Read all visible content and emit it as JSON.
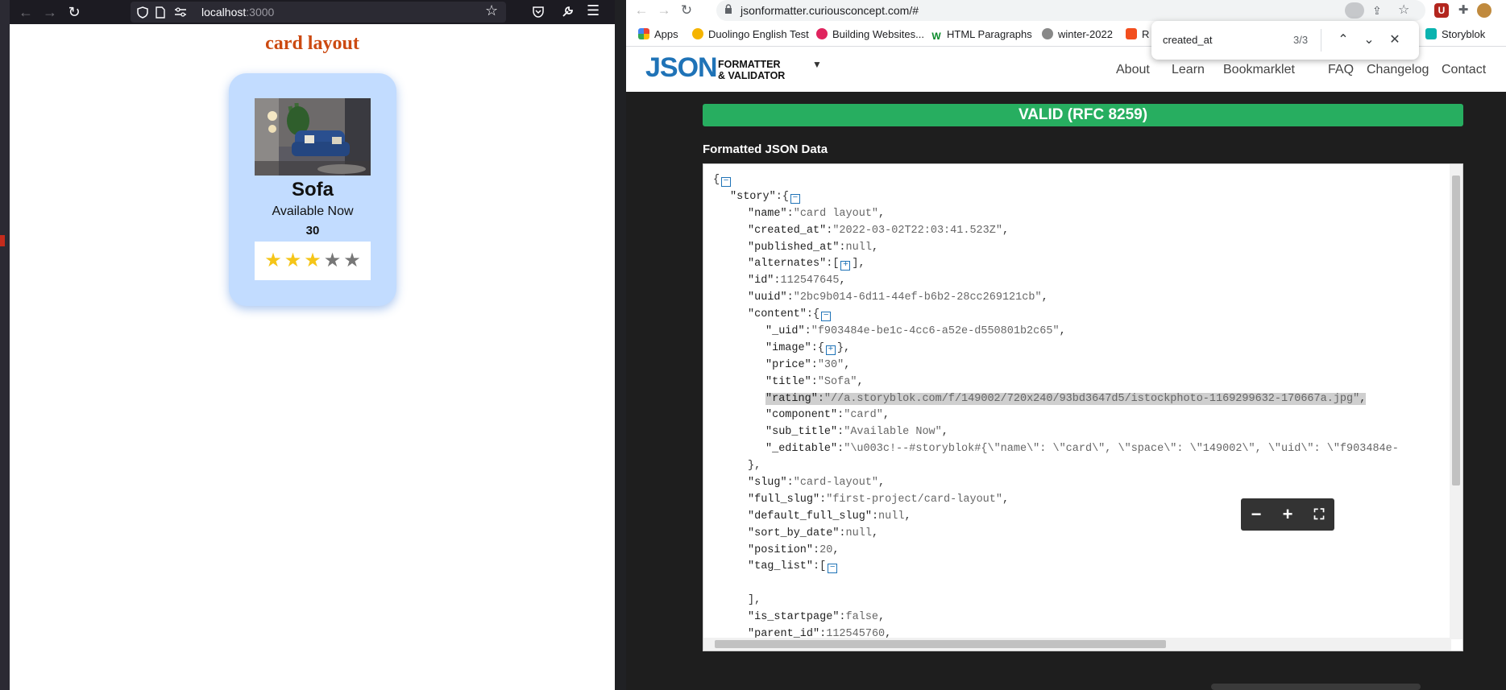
{
  "firefox": {
    "url_host": "localhost",
    "url_port": ":3000",
    "page": {
      "heading": "card layout",
      "card": {
        "image_alt": "Sofa",
        "title": "Sofa",
        "subtitle": "Available Now",
        "price": "30",
        "rating": {
          "value": 3,
          "max": 5
        }
      }
    }
  },
  "chrome": {
    "url": "jsonformatter.curiousconcept.com/#",
    "bookmarks": [
      "Apps",
      "Duolingo English Test",
      "Building Websites...",
      "HTML Paragraphs",
      "winter-2022",
      "R",
      "Storyblok"
    ],
    "find": {
      "query": "created_at",
      "count": "3/3"
    },
    "site": {
      "logo": "JSON",
      "logo_sub_1": "FORMATTER",
      "logo_sub_2": "& VALIDATOR",
      "nav": [
        "About",
        "Learn",
        "Bookmarklet",
        "FAQ",
        "Changelog",
        "Contact"
      ]
    },
    "validation": "VALID (RFC 8259)",
    "section_title": "Formatted JSON Data",
    "json_lines": [
      {
        "indent": 0,
        "parts": [
          [
            "p",
            "{"
          ],
          [
            "t",
            "−"
          ]
        ]
      },
      {
        "indent": 1,
        "parts": [
          [
            "k",
            "\"story\""
          ],
          [
            "p",
            ":{"
          ],
          [
            "t",
            "−"
          ]
        ]
      },
      {
        "indent": 2,
        "parts": [
          [
            "k",
            "\"name\""
          ],
          [
            "p",
            ":"
          ],
          [
            "s",
            "\"card layout\""
          ],
          [
            "p",
            ","
          ]
        ]
      },
      {
        "indent": 2,
        "parts": [
          [
            "k",
            "\"created_at\""
          ],
          [
            "p",
            ":"
          ],
          [
            "s",
            "\"2022-03-02T22:03:41.523Z\""
          ],
          [
            "p",
            ","
          ]
        ]
      },
      {
        "indent": 2,
        "parts": [
          [
            "k",
            "\"published_at\""
          ],
          [
            "p",
            ":"
          ],
          [
            "n",
            "null"
          ],
          [
            "p",
            ","
          ]
        ]
      },
      {
        "indent": 2,
        "parts": [
          [
            "k",
            "\"alternates\""
          ],
          [
            "p",
            ":["
          ],
          [
            "t",
            "+"
          ],
          [
            "p",
            "],"
          ]
        ]
      },
      {
        "indent": 2,
        "parts": [
          [
            "k",
            "\"id\""
          ],
          [
            "p",
            ":"
          ],
          [
            "n",
            "112547645"
          ],
          [
            "p",
            ","
          ]
        ]
      },
      {
        "indent": 2,
        "parts": [
          [
            "k",
            "\"uuid\""
          ],
          [
            "p",
            ":"
          ],
          [
            "s",
            "\"2bc9b014-6d11-44ef-b6b2-28cc269121cb\""
          ],
          [
            "p",
            ","
          ]
        ]
      },
      {
        "indent": 2,
        "parts": [
          [
            "k",
            "\"content\""
          ],
          [
            "p",
            ":{"
          ],
          [
            "t",
            "−"
          ]
        ]
      },
      {
        "indent": 3,
        "parts": [
          [
            "k",
            "\"_uid\""
          ],
          [
            "p",
            ":"
          ],
          [
            "s",
            "\"f903484e-be1c-4cc6-a52e-d550801b2c65\""
          ],
          [
            "p",
            ","
          ]
        ]
      },
      {
        "indent": 3,
        "parts": [
          [
            "k",
            "\"image\""
          ],
          [
            "p",
            ":{"
          ],
          [
            "t",
            "+"
          ],
          [
            "p",
            "},"
          ]
        ]
      },
      {
        "indent": 3,
        "parts": [
          [
            "k",
            "\"price\""
          ],
          [
            "p",
            ":"
          ],
          [
            "s",
            "\"30\""
          ],
          [
            "p",
            ","
          ]
        ]
      },
      {
        "indent": 3,
        "parts": [
          [
            "k",
            "\"title\""
          ],
          [
            "p",
            ":"
          ],
          [
            "s",
            "\"Sofa\""
          ],
          [
            "p",
            ","
          ]
        ]
      },
      {
        "indent": 3,
        "highlight": true,
        "parts": [
          [
            "k",
            "\"rating\""
          ],
          [
            "p",
            ":"
          ],
          [
            "s",
            "\"//a.storyblok.com/f/149002/720x240/93bd3647d5/istockphoto-1169299632-170667a.jpg\""
          ],
          [
            "p",
            ","
          ]
        ]
      },
      {
        "indent": 3,
        "parts": [
          [
            "k",
            "\"component\""
          ],
          [
            "p",
            ":"
          ],
          [
            "s",
            "\"card\""
          ],
          [
            "p",
            ","
          ]
        ]
      },
      {
        "indent": 3,
        "parts": [
          [
            "k",
            "\"sub_title\""
          ],
          [
            "p",
            ":"
          ],
          [
            "s",
            "\"Available Now\""
          ],
          [
            "p",
            ","
          ]
        ]
      },
      {
        "indent": 3,
        "parts": [
          [
            "k",
            "\"_editable\""
          ],
          [
            "p",
            ":"
          ],
          [
            "s",
            "\"\\u003c!--#storyblok#{\\\"name\\\": \\\"card\\\", \\\"space\\\": \\\"149002\\\", \\\"uid\\\": \\\"f903484e-"
          ]
        ]
      },
      {
        "indent": 2,
        "parts": [
          [
            "p",
            "},"
          ]
        ]
      },
      {
        "indent": 2,
        "parts": [
          [
            "k",
            "\"slug\""
          ],
          [
            "p",
            ":"
          ],
          [
            "s",
            "\"card-layout\""
          ],
          [
            "p",
            ","
          ]
        ]
      },
      {
        "indent": 2,
        "parts": [
          [
            "k",
            "\"full_slug\""
          ],
          [
            "p",
            ":"
          ],
          [
            "s",
            "\"first-project/card-layout\""
          ],
          [
            "p",
            ","
          ]
        ]
      },
      {
        "indent": 2,
        "parts": [
          [
            "k",
            "\"default_full_slug\""
          ],
          [
            "p",
            ":"
          ],
          [
            "n",
            "null"
          ],
          [
            "p",
            ","
          ]
        ]
      },
      {
        "indent": 2,
        "parts": [
          [
            "k",
            "\"sort_by_date\""
          ],
          [
            "p",
            ":"
          ],
          [
            "n",
            "null"
          ],
          [
            "p",
            ","
          ]
        ]
      },
      {
        "indent": 2,
        "parts": [
          [
            "k",
            "\"position\""
          ],
          [
            "p",
            ":"
          ],
          [
            "n",
            "20"
          ],
          [
            "p",
            ","
          ]
        ]
      },
      {
        "indent": 2,
        "parts": [
          [
            "k",
            "\"tag_list\""
          ],
          [
            "p",
            ":["
          ],
          [
            "t",
            "−"
          ]
        ]
      },
      {
        "indent": 2,
        "parts": [
          [
            "p",
            ""
          ]
        ]
      },
      {
        "indent": 2,
        "parts": [
          [
            "p",
            "],"
          ]
        ]
      },
      {
        "indent": 2,
        "parts": [
          [
            "k",
            "\"is_startpage\""
          ],
          [
            "p",
            ":"
          ],
          [
            "n",
            "false"
          ],
          [
            "p",
            ","
          ]
        ]
      },
      {
        "indent": 2,
        "parts": [
          [
            "k",
            "\"parent_id\""
          ],
          [
            "p",
            ":"
          ],
          [
            "n",
            "112545760"
          ],
          [
            "p",
            ","
          ]
        ]
      }
    ]
  },
  "colors": {
    "heading": "#cc4a11",
    "card_bg": "#c2dcff",
    "valid": "#27ae60",
    "brand": "#1f73b7",
    "star_on": "#f5c518",
    "star_off": "#777777"
  }
}
